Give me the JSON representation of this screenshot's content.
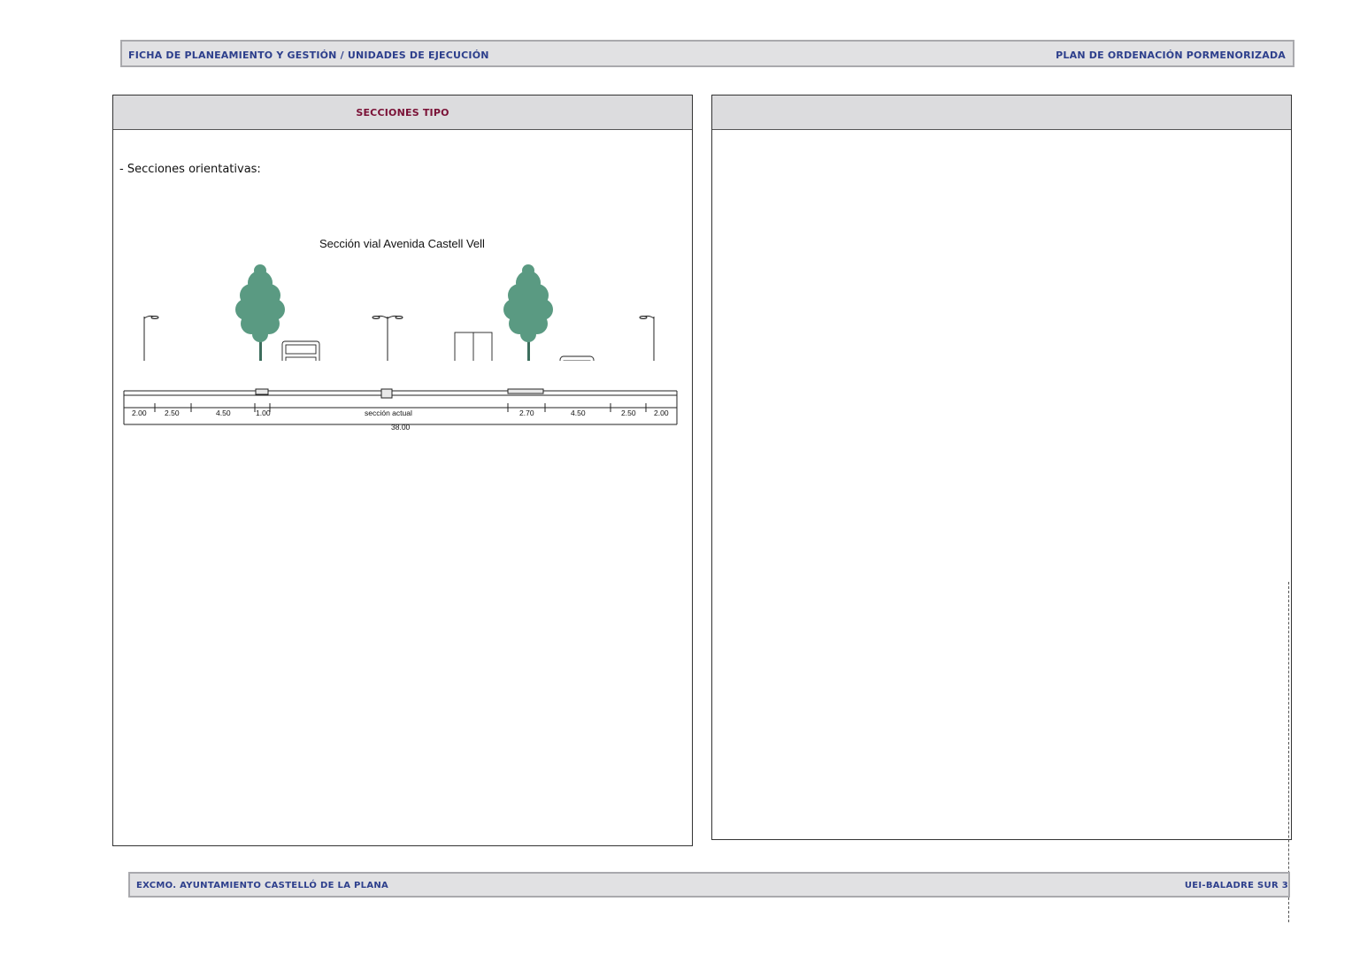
{
  "header": {
    "left": "FICHA DE PLANEAMIENTO Y GESTIÓN / UNIDADES DE EJECUCIÓN",
    "right": "PLAN DE ORDENACIÓN PORMENORIZADA"
  },
  "left_panel": {
    "title": "SECCIONES TIPO",
    "subtitle": "- Secciones orientativas:",
    "section_title": "Sección vial Avenida Castell Vell",
    "dimensions": [
      "2.00",
      "2.50",
      "4.50",
      "1.00",
      "sección actual",
      "2.70",
      "4.50",
      "2.50",
      "2.00"
    ],
    "total": "38.00"
  },
  "right_panel": {
    "title": ""
  },
  "footer": {
    "left": "EXCMO. AYUNTAMIENTO CASTELLÓ DE LA PLANA",
    "right": "UEI-BALADRE SUR  3"
  },
  "colors": {
    "header_text": "#2d3f8c",
    "panel_title": "#7a1136",
    "tree": "#5a9a82"
  }
}
